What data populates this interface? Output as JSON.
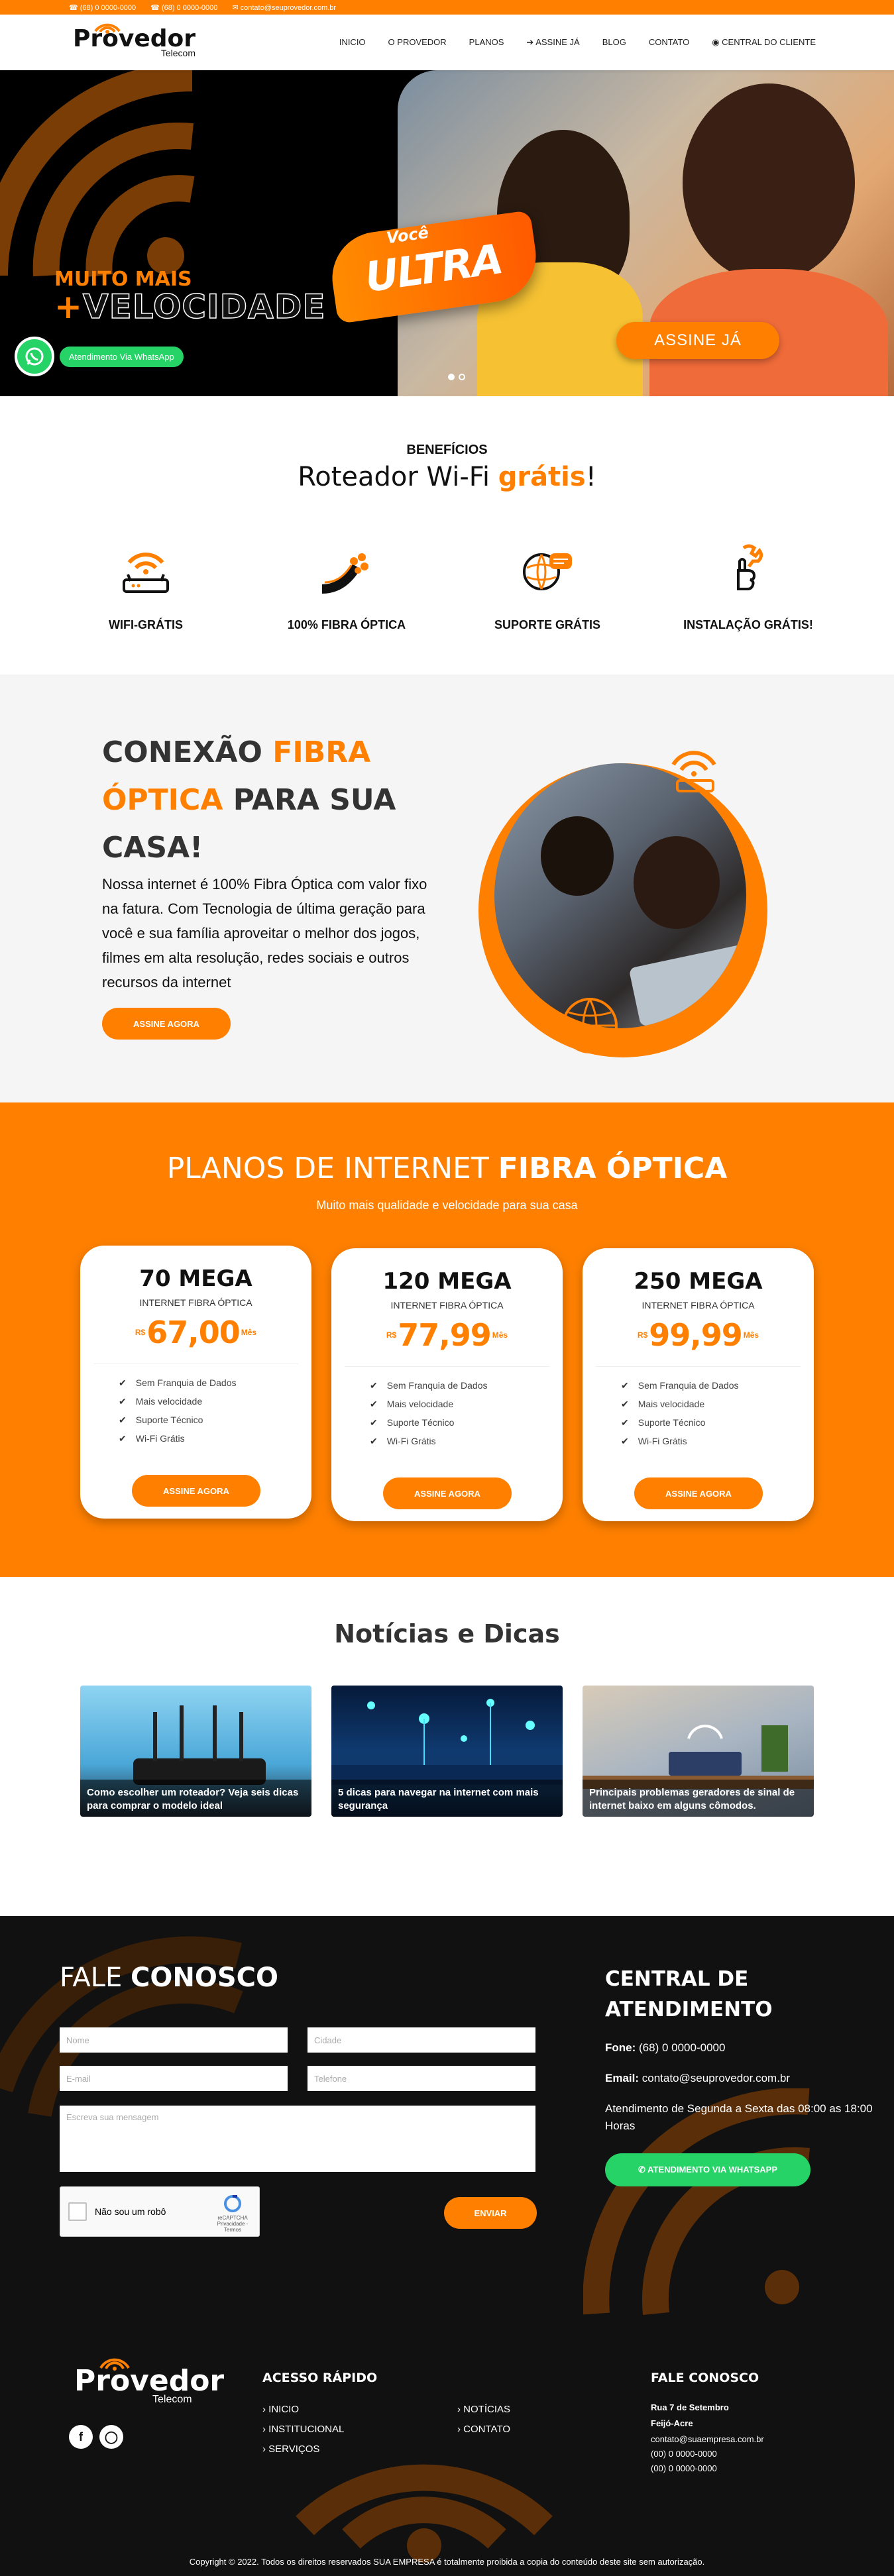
{
  "topbar": {
    "phone1": "(68) 0 0000-0000",
    "phone2": "(68) 0 0000-0000",
    "email": "contato@seuprovedor.com.br"
  },
  "brand": {
    "name": "Provedor",
    "sub": "Telecom"
  },
  "nav": {
    "items": [
      "INICIO",
      "O PROVEDOR",
      "PLANOS",
      "ASSINE JÁ",
      "BLOG",
      "CONTATO",
      "CENTRAL DO CLIENTE"
    ]
  },
  "hero": {
    "tag1": "MUITO MAIS",
    "tag2_plus": "+",
    "tag2": "VELOCIDADE",
    "badge_small": "Você",
    "badge_big": "ULTRA",
    "cta": "ASSINE JÁ",
    "whatsapp_label": "Atendimento Via WhatsApp"
  },
  "benefits": {
    "eyebrow": "BENEFÍCIOS",
    "title_prefix": "Roteador Wi-Fi ",
    "title_highlight": "grátis",
    "title_suffix": "!",
    "items": [
      {
        "label": "WIFI-GRÁTIS",
        "icon": "router-icon"
      },
      {
        "label": "100% FIBRA ÓPTICA",
        "icon": "fiber-icon"
      },
      {
        "label": "SUPORTE GRÁTIS",
        "icon": "support-icon"
      },
      {
        "label": "INSTALAÇÃO GRÁTIS!",
        "icon": "thumbs-up-icon"
      }
    ]
  },
  "connection": {
    "title_part1": "CONEXÃO ",
    "title_highlight": "FIBRA ÓPTICA",
    "title_part2": " PARA SUA CASA!",
    "text": "Nossa internet é 100% Fibra Óptica com valor fixo na fatura. Com Tecnologia de última geração para você e sua família aproveitar o melhor dos jogos, filmes em alta resolução, redes sociais e outros recursos da internet",
    "cta": "ASSINE AGORA"
  },
  "plans": {
    "title_light": "PLANOS DE INTERNET ",
    "title_bold": "FIBRA ÓPTICA",
    "subtitle": "Muito mais qualidade e velocidade para sua casa",
    "items": [
      {
        "name": "70 MEGA",
        "type": "INTERNET FIBRA ÓPTICA",
        "currency": "R$",
        "price": "67,00",
        "period": "Mês",
        "features": [
          "Sem Franquia de Dados",
          "Mais velocidade",
          "Suporte Técnico",
          "Wi-Fi Grátis"
        ],
        "cta": "ASSINE AGORA"
      },
      {
        "name": "120 MEGA",
        "type": "INTERNET FIBRA ÓPTICA",
        "currency": "R$",
        "price": "77,99",
        "period": "Mês",
        "features": [
          "Sem Franquia de Dados",
          "Mais velocidade",
          "Suporte Técnico",
          "Wi-Fi Grátis"
        ],
        "cta": "ASSINE AGORA"
      },
      {
        "name": "250 MEGA",
        "type": "INTERNET FIBRA ÓPTICA",
        "currency": "R$",
        "price": "99,99",
        "period": "Mês",
        "features": [
          "Sem Franquia de Dados",
          "Mais velocidade",
          "Suporte Técnico",
          "Wi-Fi Grátis"
        ],
        "cta": "ASSINE AGORA"
      }
    ]
  },
  "news": {
    "title": "Notícias e Dicas",
    "posts": [
      "Como escolher um roteador? Veja seis dicas para comprar o modelo ideal",
      "5 dicas para navegar na internet com mais segurança",
      "Principais problemas geradores de sinal de internet baixo em alguns cômodos."
    ]
  },
  "contact": {
    "title_light": "FALE ",
    "title_bold": "CONOSCO",
    "placeholders": {
      "name": "Nome",
      "city": "Cidade",
      "email": "E-mail",
      "phone": "Telefone",
      "message": "Escreva sua mensagem"
    },
    "captcha_label": "Não sou um robô",
    "captcha_brand": "reCAPTCHA",
    "captcha_links": "Privacidade - Termos",
    "send": "ENVIAR"
  },
  "central": {
    "title": "CENTRAL DE ATENDIMENTO",
    "phone_label": "Fone:",
    "phone": "(68) 0 0000-0000",
    "email_label": "Email:",
    "email": "contato@seuprovedor.com.br",
    "hours": "Atendimento de Segunda a Sexta das 08:00 as 18:00 Horas",
    "whatsapp_btn": "ATENDIMENTO VIA WHATSAPP"
  },
  "footer": {
    "quick_title": "ACESSO RÁPIDO",
    "links_col1": [
      "INICIO",
      "INSTITUCIONAL",
      "SERVIÇOS"
    ],
    "links_col2": [
      "NOTÍCIAS",
      "CONTATO"
    ],
    "contact_title": "FALE CONOSCO",
    "address1": "Rua 7 de Setembro",
    "address2": "Feijó-Acre",
    "email": "contato@suaempresa.com.br",
    "phone1": "(00) 0 0000-0000",
    "phone2": "(00) 0 0000-0000",
    "copyright": "Copyright © 2022. Todos os direitos reservados SUA EMPRESA é totalmente proibida a copia do conteúdo deste site sem autorização."
  },
  "colors": {
    "accent": "#ff8000",
    "dark": "#111111",
    "whatsapp": "#25d366"
  }
}
